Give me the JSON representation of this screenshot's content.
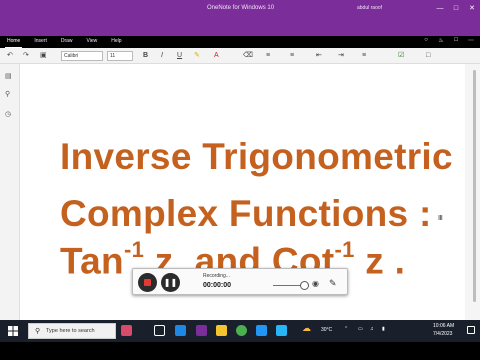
{
  "window": {
    "title": "OneNote for Windows 10",
    "user": "abdul raoof"
  },
  "ribbon": {
    "tabs": [
      "Home",
      "Insert",
      "Draw",
      "View",
      "Help"
    ],
    "active_tab": "Home",
    "font_name": "Calibri",
    "font_size": "11"
  },
  "page": {
    "line1": "Inverse Trigonometric",
    "line2": "Complex Functions :",
    "line3_a": "Tan",
    "line3_sup1": "-1",
    "line3_b": " z, and Cot",
    "line3_sup2": "-1",
    "line3_c": " z ."
  },
  "recorder": {
    "status": "Recording...",
    "time": "00:00:00"
  },
  "taskbar": {
    "search_placeholder": "Type here to search",
    "weather": "30°C",
    "time": "10:06 AM",
    "date": "7/4/2023"
  },
  "colors": {
    "titlebar": "#7b2d9a",
    "heading": "#c5611f",
    "taskbar": "#1a1f2c"
  }
}
